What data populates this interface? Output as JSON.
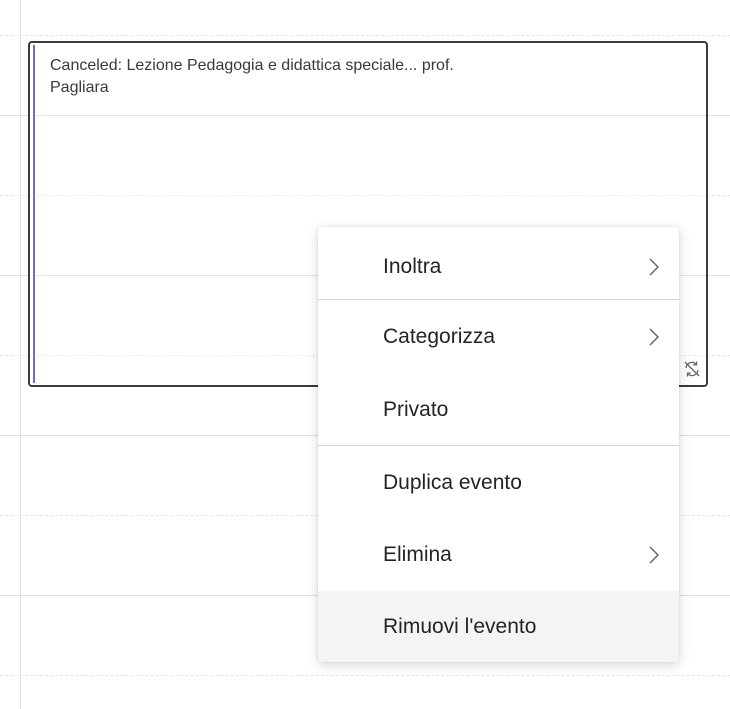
{
  "event": {
    "title_line1": "Canceled: Lezione Pedagogia e didattica speciale... prof.",
    "title_line2": "Pagliara",
    "sync_icon": "sync-off-icon"
  },
  "context_menu": {
    "items": [
      {
        "label": "Inoltra",
        "has_submenu": true
      },
      {
        "label": "Categorizza",
        "has_submenu": true
      },
      {
        "label": "Privato",
        "has_submenu": false
      },
      {
        "label": "Duplica evento",
        "has_submenu": false
      },
      {
        "label": "Elimina",
        "has_submenu": true
      },
      {
        "label": "Rimuovi l'evento",
        "has_submenu": false,
        "hovered": true
      }
    ]
  },
  "colors": {
    "event_border": "#3b3b3b",
    "event_accent": "#6f6fc6",
    "hover_bg": "#f4f4f4",
    "grid_line": "#e1e1e1"
  }
}
